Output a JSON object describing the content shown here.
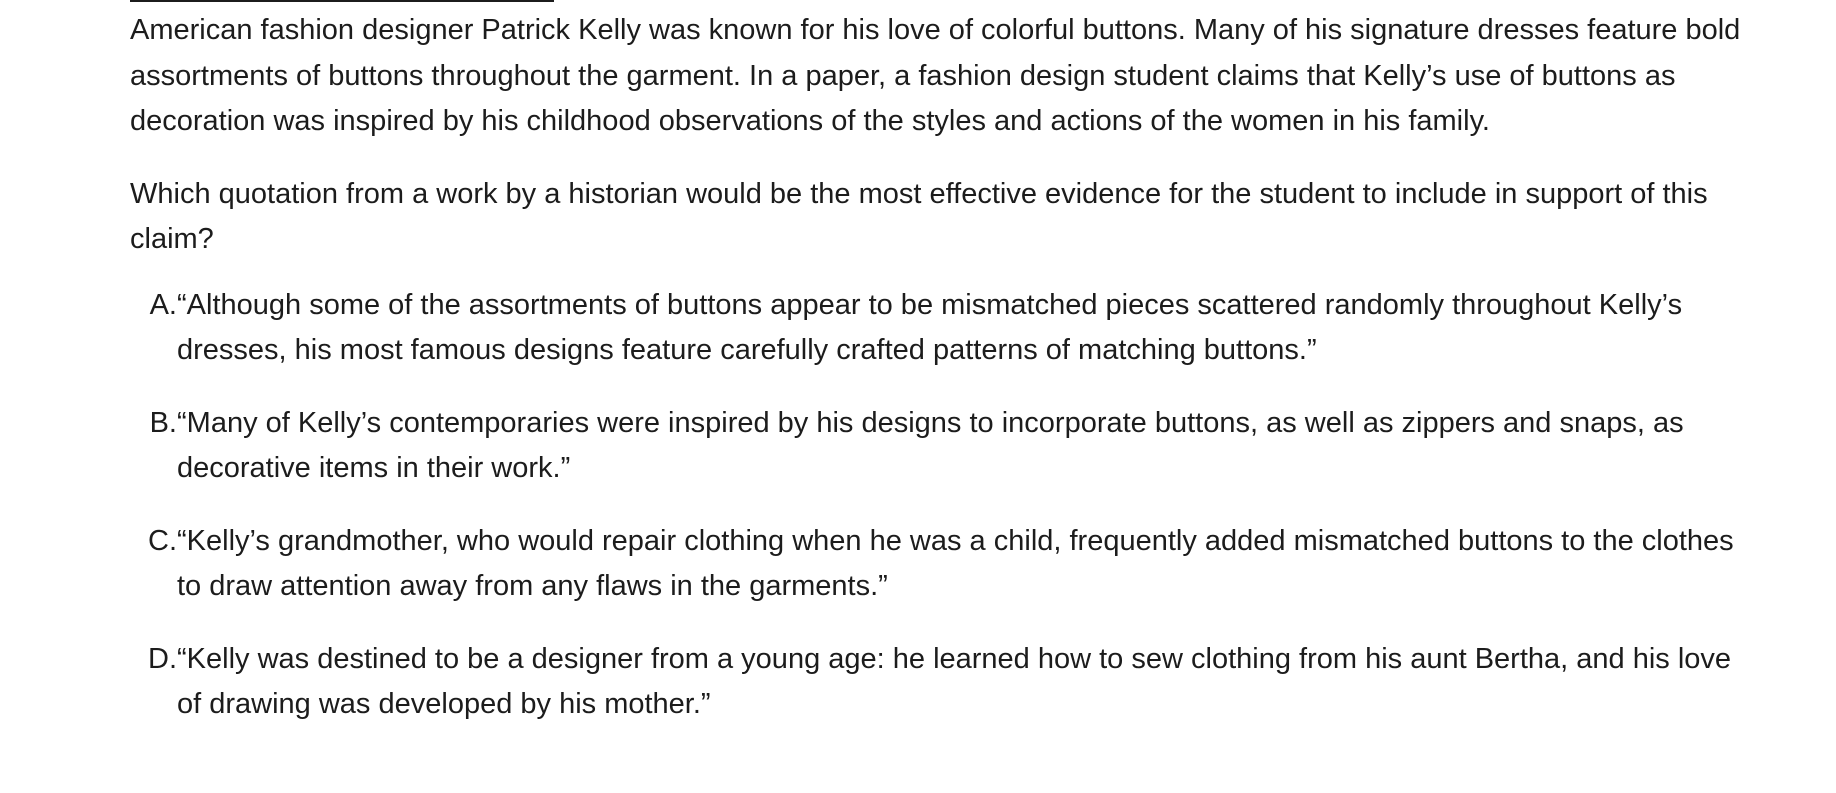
{
  "passage": {
    "text": "American fashion designer Patrick Kelly was known for his love of colorful buttons. Many of his signature dresses feature bold assortments of buttons throughout the garment. In a paper, a fashion design student claims that Kelly’s use of buttons as decoration was inspired by his childhood observations of the styles and actions of the women in his family."
  },
  "question": {
    "text": "Which quotation from a work by a historian would be the most effective evidence for the student to include in support of this claim?"
  },
  "choices": [
    {
      "letter": "A.",
      "text": "“Although some of the assortments of buttons appear to be mismatched pieces scattered randomly throughout Kelly’s dresses, his most famous designs feature carefully crafted patterns of matching buttons.”"
    },
    {
      "letter": "B.",
      "text": "“Many of Kelly’s contemporaries were inspired by his designs to incorporate buttons, as well as zippers and snaps, as decorative items in their work.”"
    },
    {
      "letter": "C.",
      "text": "“Kelly’s grandmother, who would repair clothing when he was a child, frequently added mismatched buttons to the clothes to draw attention away from any flaws in the garments.”"
    },
    {
      "letter": "D.",
      "text": "“Kelly was destined to be a designer from a young age: he learned how to sew clothing from his aunt Bertha, and his love of drawing was developed by his mother.”"
    }
  ]
}
